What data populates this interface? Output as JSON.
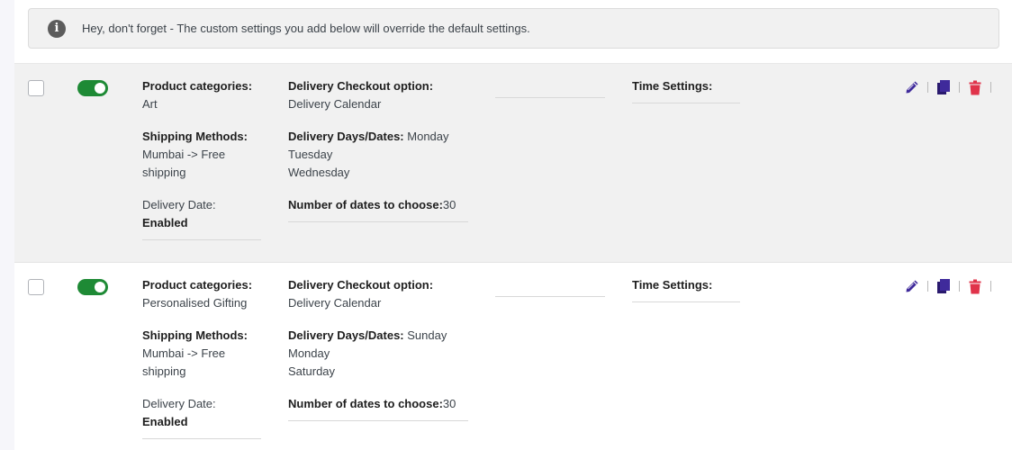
{
  "notice": {
    "icon": "info-icon",
    "text": "Hey, don't forget - The custom settings you add below will override the default settings."
  },
  "colors": {
    "toggle_on": "#1e8a35",
    "edit_icon": "#3f2a9b",
    "duplicate_icon": "#3f2a9b",
    "delete_icon": "#e0334a"
  },
  "rules": [
    {
      "enabled": true,
      "product_categories_label": "Product categories:",
      "product_categories": "Art",
      "shipping_methods_label": "Shipping Methods:",
      "shipping_methods": "Mumbai -> Free shipping",
      "delivery_date_label": "Delivery Date:",
      "delivery_date": "Enabled",
      "checkout_option_label": "Delivery Checkout option:",
      "checkout_option": "Delivery Calendar",
      "days_label": "Delivery Days/Dates:",
      "days": [
        "Monday",
        "Tuesday",
        "Wednesday"
      ],
      "num_dates_label": "Number of dates to choose:",
      "num_dates": "30",
      "time_settings_label": "Time Settings:",
      "actions": [
        "edit-icon",
        "duplicate-icon",
        "delete-icon"
      ]
    },
    {
      "enabled": true,
      "product_categories_label": "Product categories:",
      "product_categories": "Personalised Gifting",
      "shipping_methods_label": "Shipping Methods:",
      "shipping_methods": "Mumbai -> Free shipping",
      "delivery_date_label": "Delivery Date:",
      "delivery_date": "Enabled",
      "checkout_option_label": "Delivery Checkout option:",
      "checkout_option": "Delivery Calendar",
      "days_label": "Delivery Days/Dates:",
      "days": [
        "Sunday",
        "Monday",
        "Saturday"
      ],
      "num_dates_label": "Number of dates to choose:",
      "num_dates": "30",
      "time_settings_label": "Time Settings:",
      "actions": [
        "edit-icon",
        "duplicate-icon",
        "delete-icon"
      ]
    }
  ]
}
